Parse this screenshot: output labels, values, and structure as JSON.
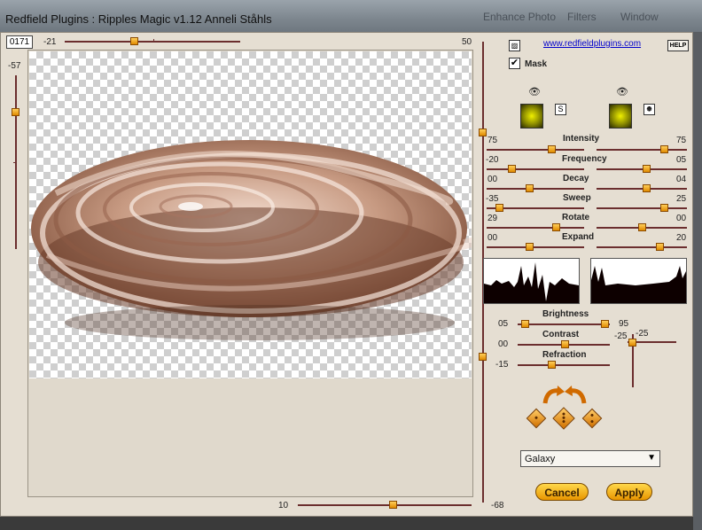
{
  "window": {
    "title": "Redfield Plugins : Ripples Magic v1.12   Anneli Ståhls",
    "bg_titles": [
      "Enhance Photo",
      "Filters",
      "Window"
    ]
  },
  "top": {
    "id_value": "0171",
    "hslider_min": "-21",
    "hslider_max": "50",
    "left_vslider_value": "-57"
  },
  "bottom": {
    "hslider_value": "10",
    "vslider_bottom": "-68"
  },
  "links": {
    "url": "www.redfieldplugins.com",
    "help": "HELP"
  },
  "mask": {
    "label": "Mask",
    "checked": "✔"
  },
  "swatches": {
    "btn_s": "S",
    "btn_swirl": "🞿"
  },
  "params": [
    {
      "name": "Intensity",
      "left": "75",
      "right": "75"
    },
    {
      "name": "Frequency",
      "left": "-20",
      "right": "05"
    },
    {
      "name": "Decay",
      "left": "00",
      "right": "04"
    },
    {
      "name": "Sweep",
      "left": "-35",
      "right": "25"
    },
    {
      "name": "Rotate",
      "left": "29",
      "right": "00"
    },
    {
      "name": "Expand",
      "left": "00",
      "right": "20"
    }
  ],
  "lighting": {
    "brightness": {
      "label": "Brightness",
      "left": "05",
      "right": "95"
    },
    "contrast": {
      "label": "Contrast",
      "left": "00",
      "right": "-25"
    },
    "refraction": {
      "label": "Refraction",
      "left": "-15"
    },
    "side_value": "-25"
  },
  "preset": {
    "selected": "Galaxy",
    "arrow": "▼"
  },
  "buttons": {
    "cancel": "Cancel",
    "apply": "Apply"
  },
  "colors": {
    "panel": "#e5ded2",
    "slider_track": "#6b2e2e",
    "knob": "#ffb020",
    "button": "#f0b020"
  }
}
